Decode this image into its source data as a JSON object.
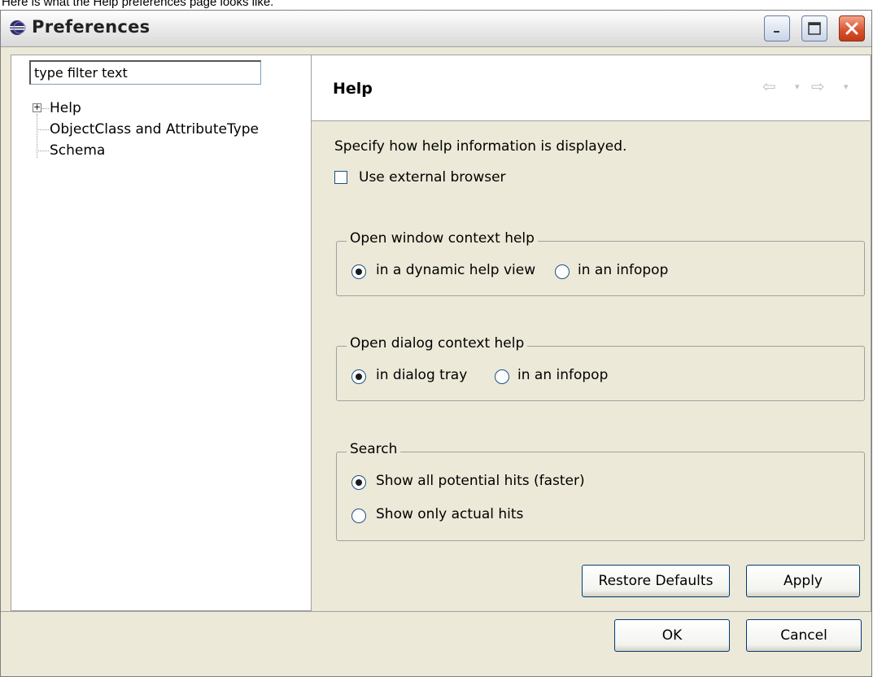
{
  "caption": "Here is what the Help preferences page looks like.",
  "window": {
    "title": "Preferences"
  },
  "filter": {
    "value": "type filter text"
  },
  "tree": {
    "items": [
      {
        "label": "Help",
        "expandable": true
      },
      {
        "label": "ObjectClass and AttributeType",
        "expandable": false
      },
      {
        "label": "Schema",
        "expandable": false
      }
    ]
  },
  "page": {
    "title": "Help",
    "description": "Specify how help information is displayed.",
    "external_browser_label": "Use external browser",
    "window_group": {
      "title": "Open window context help",
      "options": [
        "in a dynamic help view",
        "in an infopop"
      ],
      "selected": 0
    },
    "dialog_group": {
      "title": "Open dialog context help",
      "options": [
        "in dialog tray",
        "in an infopop"
      ],
      "selected": 0
    },
    "search_group": {
      "title": "Search",
      "options": [
        "Show all potential hits (faster)",
        "Show only actual hits"
      ],
      "selected": 0
    },
    "restore_defaults_label": "Restore Defaults",
    "apply_label": "Apply"
  },
  "footer": {
    "ok_label": "OK",
    "cancel_label": "Cancel"
  },
  "colors": {
    "dialog_bg": "#ece9d8",
    "button_border": "#003c74",
    "close_red": "#d6512c"
  }
}
